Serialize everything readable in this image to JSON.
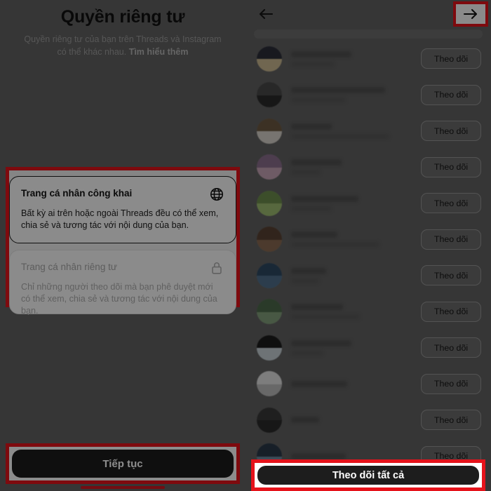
{
  "left_panel": {
    "title": "Quyền riêng tư",
    "subtitle_part1": "Quyền riêng tư của bạn trên Threads và Instagram có thể khác nhau. ",
    "subtitle_link": "Tìm hiểu thêm",
    "options": [
      {
        "title": "Trang cá nhân công khai",
        "description": "Bất kỳ ai trên hoặc ngoài Threads đều có thể xem, chia sẻ và tương tác với nội dung của bạn.",
        "icon": "globe-icon",
        "selected": true
      },
      {
        "title": "Trang cá nhân riêng tư",
        "description": "Chỉ những người theo dõi mà bạn phê duyệt mới có thể xem, chia sẻ và tương tác với nội dung của bạn.",
        "icon": "lock-icon",
        "selected": false
      }
    ],
    "continue_label": "Tiếp tục"
  },
  "right_panel": {
    "back_icon": "arrow-left-icon",
    "next_icon": "arrow-right-icon",
    "follow_all_label": "Theo dõi tất cả",
    "follow_label": "Theo dõi",
    "rows": [
      {
        "name_width": 86,
        "sub_width": 62,
        "av_top": "#2d2f3a",
        "av_bot": "#cdbb92"
      },
      {
        "name_width": 134,
        "sub_width": 78,
        "av_top": "#4a4a4a",
        "av_bot": "#2b2b2b"
      },
      {
        "name_width": 58,
        "sub_width": 140,
        "av_top": "#6e5a43",
        "av_bot": "#d9d4cc"
      },
      {
        "name_width": 72,
        "sub_width": 42,
        "av_top": "#8c6f8e",
        "av_bot": "#c9a7b8"
      },
      {
        "name_width": 96,
        "sub_width": 58,
        "av_top": "#6d8f4e",
        "av_bot": "#9fbd72"
      },
      {
        "name_width": 66,
        "sub_width": 126,
        "av_top": "#5a4334",
        "av_bot": "#8a6b52"
      },
      {
        "name_width": 50,
        "sub_width": 40,
        "av_top": "#2f4a63",
        "av_bot": "#50708c"
      },
      {
        "name_width": 74,
        "sub_width": 98,
        "av_top": "#4e6b4c",
        "av_bot": "#83a07c"
      },
      {
        "name_width": 86,
        "sub_width": 46,
        "av_top": "#1d1d1d",
        "av_bot": "#c8d2d8"
      },
      {
        "name_width": 80,
        "sub_width": 0,
        "av_top": "#e3e3e3",
        "av_bot": "#bdbdbd"
      },
      {
        "name_width": 40,
        "sub_width": 0,
        "av_top": "#3a3a3a",
        "av_bot": "#2a2a2a"
      },
      {
        "name_width": 78,
        "sub_width": 0,
        "av_top": "#2b3a4a",
        "av_bot": "#6f8aa0"
      }
    ]
  },
  "colors": {
    "highlight": "#e5131b",
    "overlay": "#636363",
    "primary_button": "#1d1d1d"
  }
}
